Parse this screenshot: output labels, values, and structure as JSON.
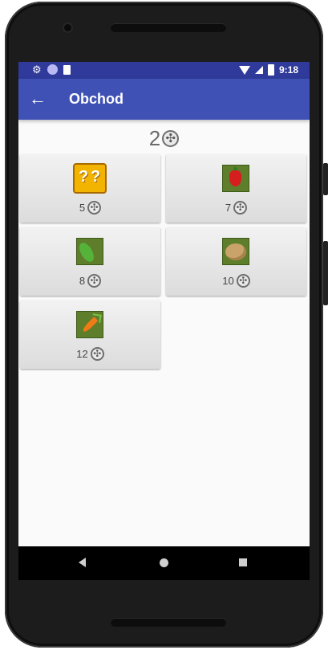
{
  "app": {
    "title": "Obchod"
  },
  "status_bar": {
    "time": "9:18"
  },
  "shop": {
    "balance": "2",
    "items": [
      {
        "name": "mystery-box",
        "price": "5"
      },
      {
        "name": "pepper",
        "price": "7"
      },
      {
        "name": "peas",
        "price": "8"
      },
      {
        "name": "potato",
        "price": "10"
      },
      {
        "name": "carrot",
        "price": "12"
      }
    ]
  },
  "colors": {
    "app_bar": "#3f51b5",
    "status_bar": "#2f3a9a",
    "background": "#fafafa"
  },
  "icons": [
    "back-arrow-icon",
    "coin-icon",
    "nav-back-icon",
    "nav-home-icon",
    "nav-recents-icon"
  ]
}
